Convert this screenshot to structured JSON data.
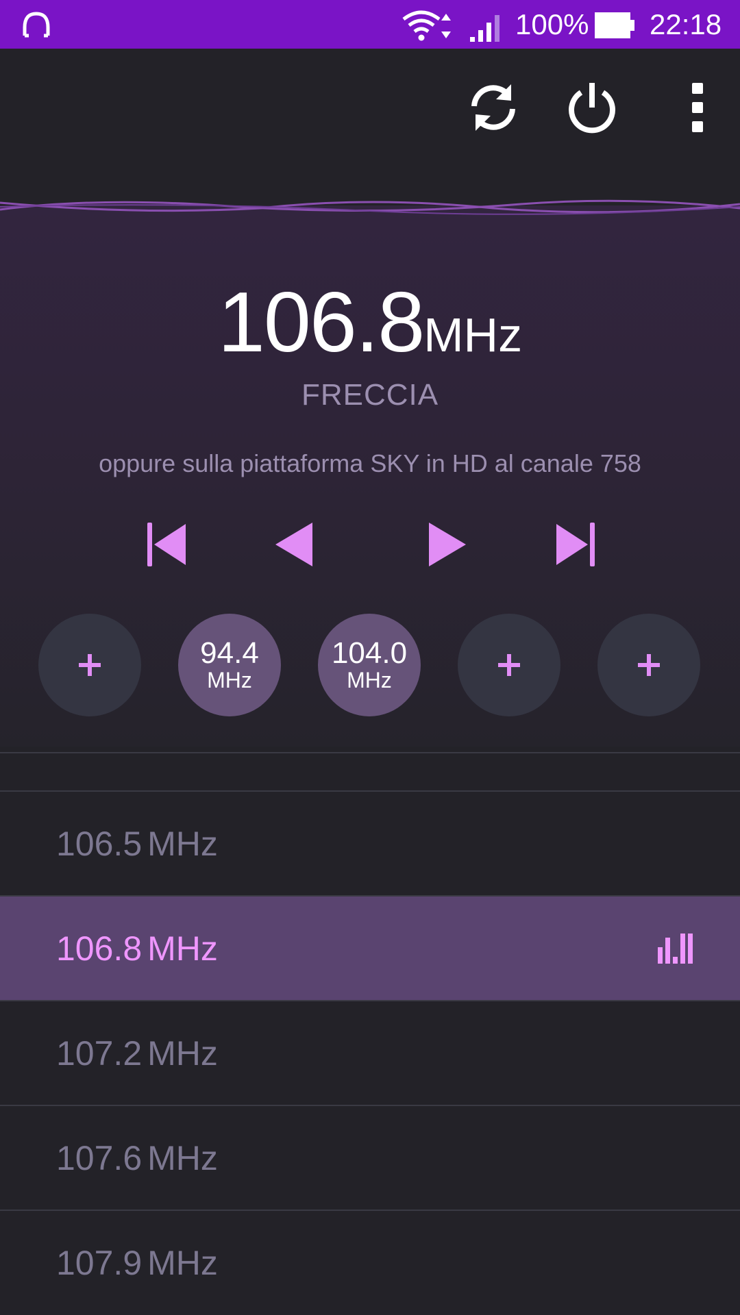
{
  "status_bar": {
    "battery_percent": "100%",
    "time": "22:18"
  },
  "now_playing": {
    "frequency": "106.8",
    "unit": "MHz",
    "station_name": "FRECCIA",
    "rds_text": "oppure sulla piattaforma SKY in HD al canale 758"
  },
  "presets": [
    {
      "frequency": "",
      "unit": ""
    },
    {
      "frequency": "94.4",
      "unit": "MHz"
    },
    {
      "frequency": "104.0",
      "unit": "MHz"
    },
    {
      "frequency": "",
      "unit": ""
    },
    {
      "frequency": "",
      "unit": ""
    }
  ],
  "stations": [
    {
      "frequency": "106.5",
      "unit": "MHz"
    },
    {
      "frequency": "106.8",
      "unit": "MHz"
    },
    {
      "frequency": "107.2",
      "unit": "MHz"
    },
    {
      "frequency": "107.6",
      "unit": "MHz"
    },
    {
      "frequency": "107.9",
      "unit": "MHz"
    }
  ],
  "colors": {
    "status_bar": "#7a14c6",
    "accent": "#ef96ff",
    "active_row": "#5a4470",
    "preset_empty": "#343542",
    "preset_filled": "#665379"
  }
}
